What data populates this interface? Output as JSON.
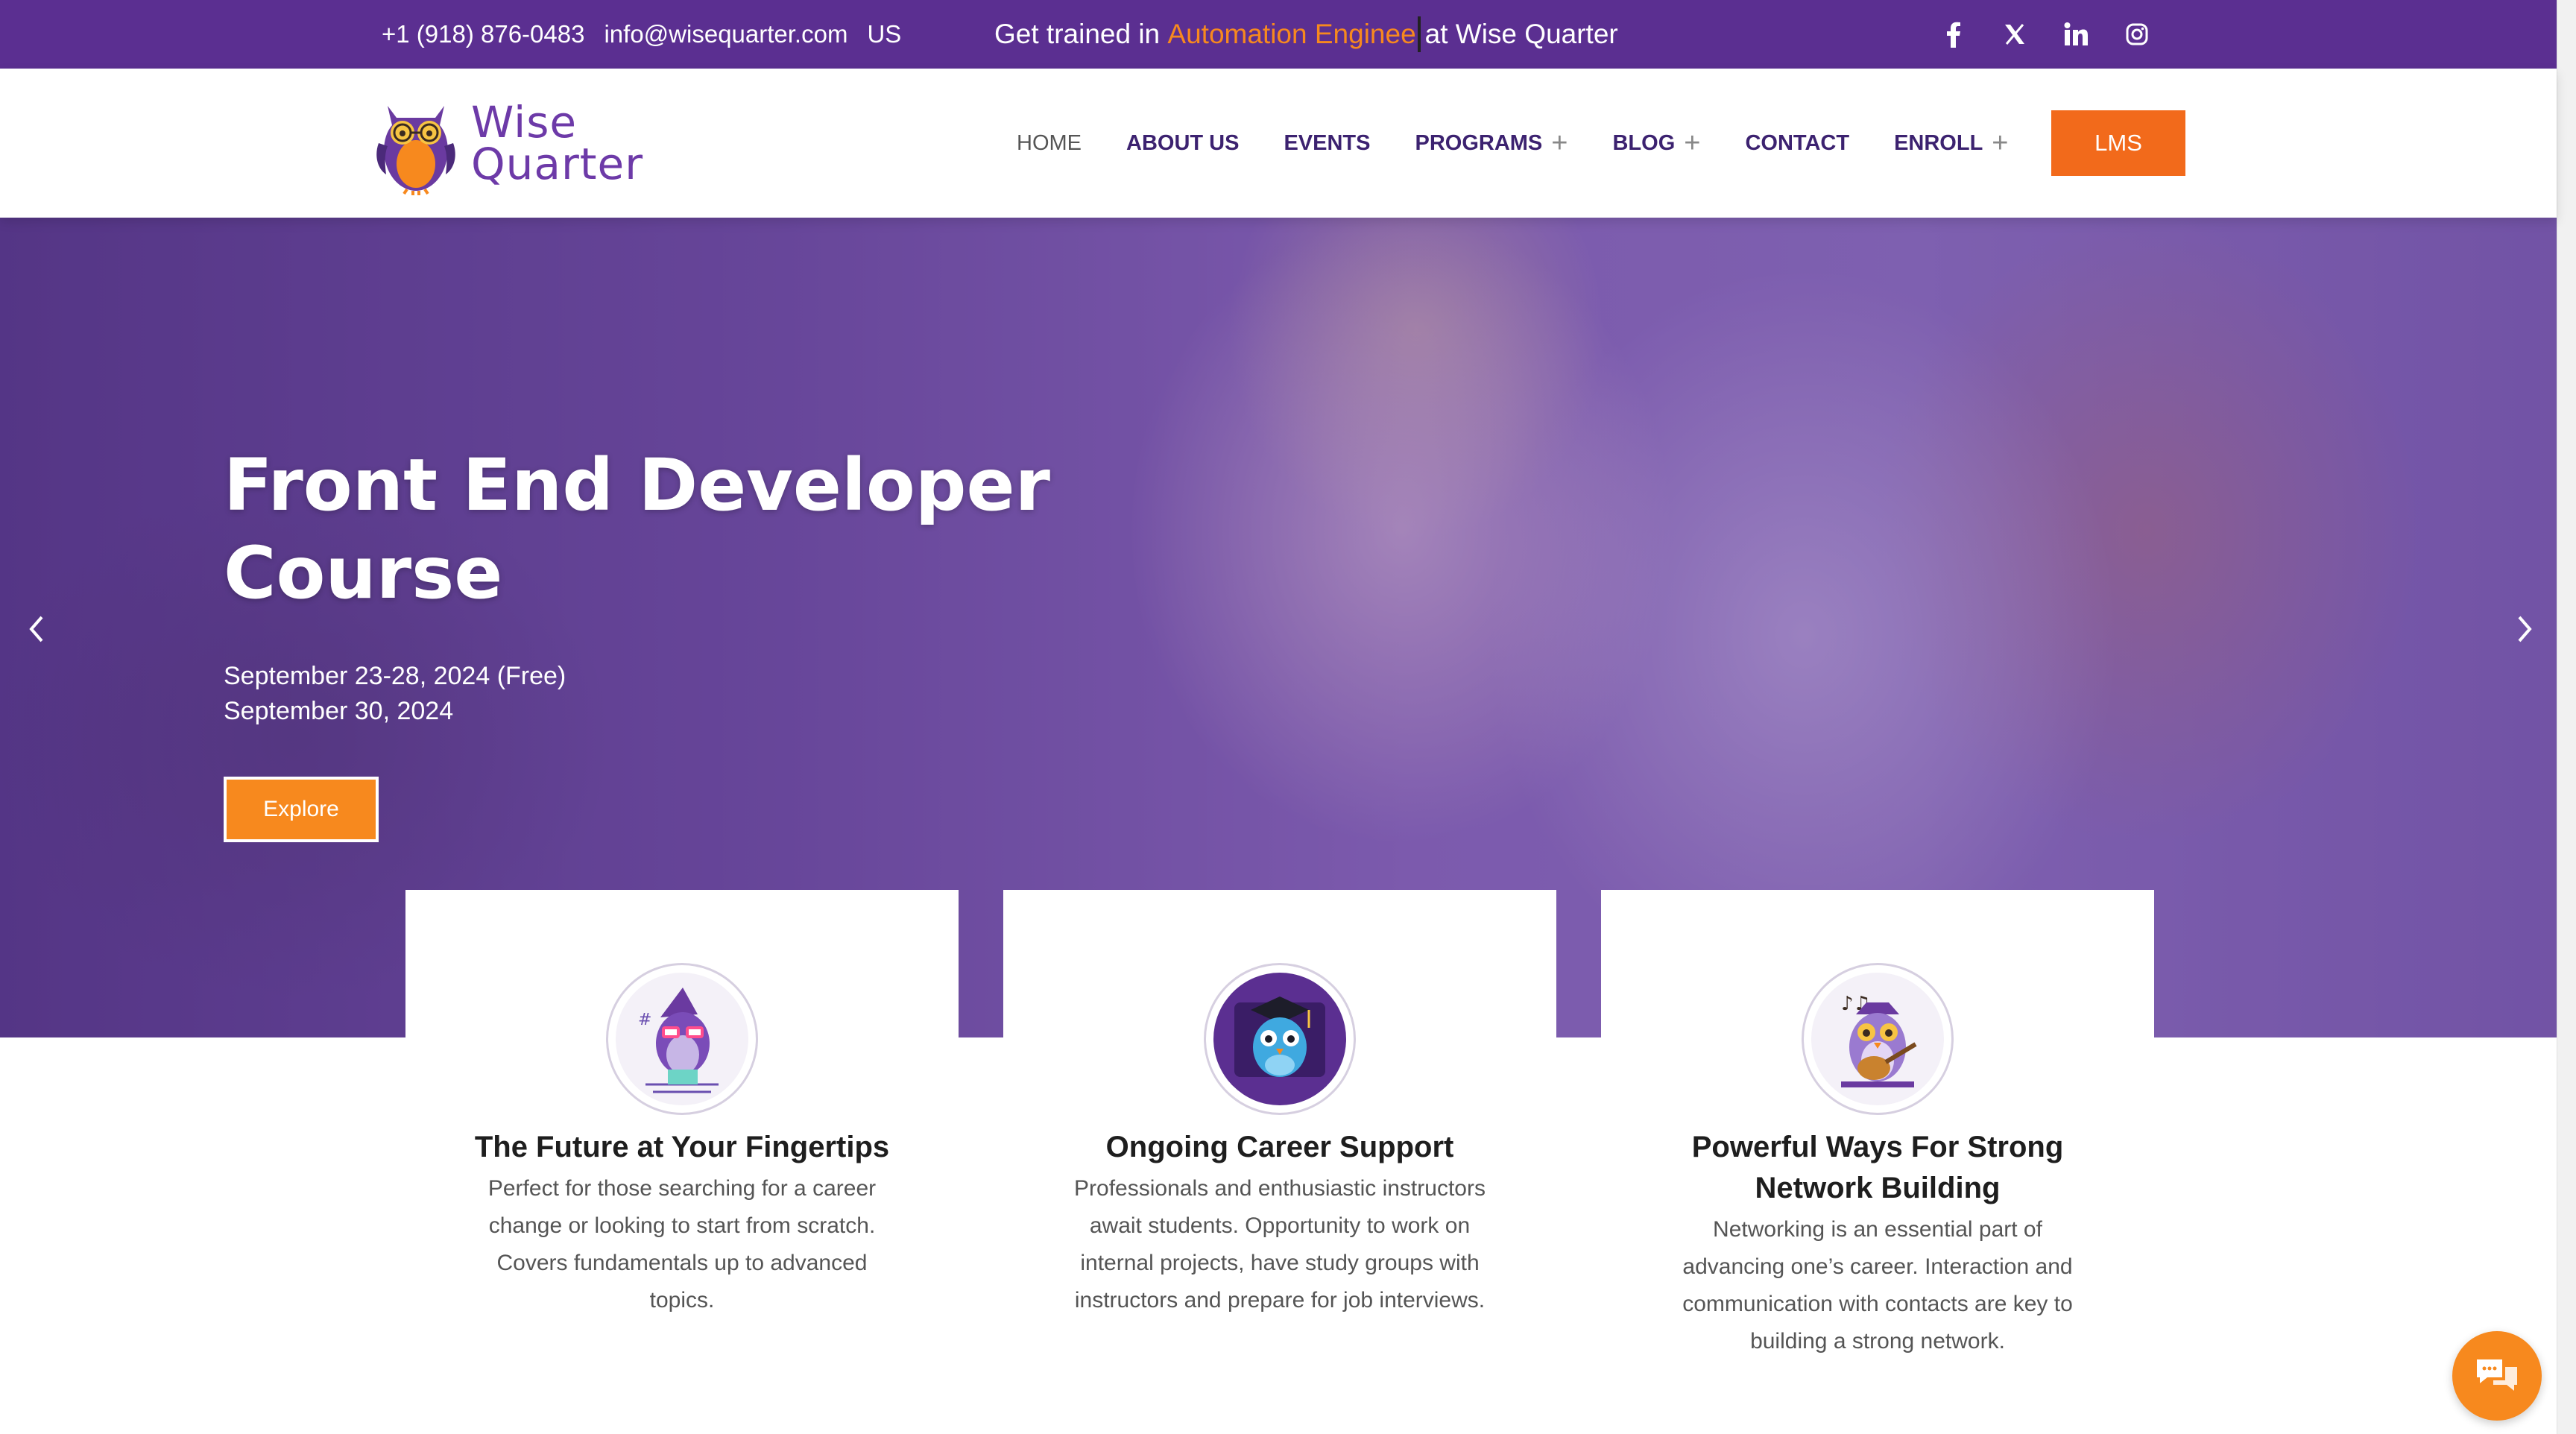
{
  "topbar": {
    "phone": "+1 (918) 876-0483",
    "email": "info@wisequarter.com",
    "region": "US",
    "promo_prefix": "Get trained in ",
    "promo_accent": "Automation Enginee",
    "promo_suffix": "at Wise Quarter",
    "social": [
      "facebook-icon",
      "x-icon",
      "linkedin-icon",
      "instagram-icon"
    ]
  },
  "header": {
    "logo_line1": "Wise",
    "logo_line2": "Quarter",
    "nav": {
      "home": "HOME",
      "about": "ABOUT US",
      "events": "EVENTS",
      "programs": "PROGRAMS",
      "blog": "BLOG",
      "contact": "CONTACT",
      "enroll": "ENROLL"
    },
    "lms_label": "LMS"
  },
  "hero": {
    "title": "Front End Developer Course",
    "date_line1": "September 23-28, 2024 (Free)",
    "date_line2": "September 30, 2024",
    "cta_label": "Explore"
  },
  "cards": [
    {
      "title": "The Future at Your Fingertips",
      "body": "Perfect for those searching for a career change or looking to start from scratch. Covers fundamentals up to advanced topics."
    },
    {
      "title": "Ongoing Career Support",
      "body": "Professionals and enthusiastic instructors await students. Opportunity to work on internal projects, have study groups with instructors and prepare for job interviews."
    },
    {
      "title": "Powerful Ways For Strong Network Building",
      "body": "Networking is an essential part of advancing one’s career. Interaction and communication with contacts are key to building a strong network."
    }
  ],
  "colors": {
    "brand_purple": "#5b2f91",
    "accent_orange": "#f7891e",
    "lms_orange": "#f26a1b",
    "nav_text": "#3c2270"
  }
}
